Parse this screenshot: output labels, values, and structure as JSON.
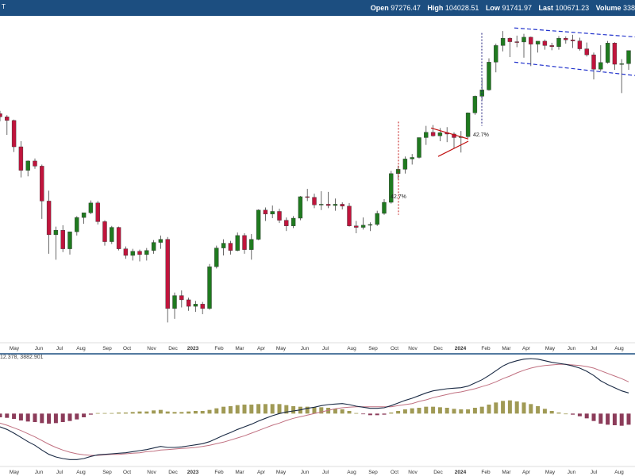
{
  "header": {
    "symbol_fragment": "T",
    "open_label": "Open",
    "open_value": "97276.47",
    "high_label": "High",
    "high_value": "104028.51",
    "low_label": "Low",
    "low_value": "91741.97",
    "last_label": "Last",
    "last_value": "100671.23",
    "volume_label": "Volume",
    "volume_value": "338"
  },
  "macd_readout": "12.378, 3882.901",
  "colors": {
    "up": "#1f7a1f",
    "down": "#c0143c",
    "header": "#1c4e80",
    "macd_line": "#1a2a44",
    "signal_line": "#c07080",
    "hist_pos": "#a09a55",
    "hist_neg": "#8c3c5a",
    "channel": "#2233cc",
    "annotation": "#c01010"
  },
  "annotations": [
    {
      "text": "42.7%"
    },
    {
      "text": "42.7%"
    }
  ],
  "chart_data": [
    {
      "type": "candlestick",
      "timeframe": "weekly",
      "x_axis_labels": [
        "May",
        "Jun",
        "Jul",
        "Aug",
        "Sep",
        "Oct",
        "Nov",
        "Dec",
        "2023",
        "Feb",
        "Mar",
        "Apr",
        "May",
        "Jun",
        "Jul",
        "Aug",
        "Sep",
        "Oct",
        "Nov",
        "Dec",
        "2024",
        "Feb",
        "Mar",
        "Apr",
        "May",
        "Jun",
        "Jul",
        "Aug"
      ],
      "series": [
        {
          "o": 47500,
          "h": 48200,
          "l": 45600,
          "c": 46700
        },
        {
          "o": 46700,
          "h": 47100,
          "l": 42400,
          "c": 45800
        },
        {
          "o": 45800,
          "h": 46000,
          "l": 38700,
          "c": 39800
        },
        {
          "o": 39800,
          "h": 41000,
          "l": 33800,
          "c": 35100
        },
        {
          "o": 35100,
          "h": 37000,
          "l": 34000,
          "c": 36900
        },
        {
          "o": 36900,
          "h": 37400,
          "l": 35400,
          "c": 35900
        },
        {
          "o": 35900,
          "h": 36200,
          "l": 27100,
          "c": 29800
        },
        {
          "o": 29800,
          "h": 31500,
          "l": 22500,
          "c": 24900
        },
        {
          "o": 24900,
          "h": 26000,
          "l": 21800,
          "c": 25500
        },
        {
          "o": 25500,
          "h": 26200,
          "l": 22700,
          "c": 23100
        },
        {
          "o": 23100,
          "h": 25300,
          "l": 22400,
          "c": 25300
        },
        {
          "o": 25300,
          "h": 27500,
          "l": 24800,
          "c": 27300
        },
        {
          "o": 27300,
          "h": 27600,
          "l": 26400,
          "c": 28000
        },
        {
          "o": 28000,
          "h": 29900,
          "l": 27800,
          "c": 29500
        },
        {
          "o": 29500,
          "h": 29800,
          "l": 26300,
          "c": 26700
        },
        {
          "o": 26700,
          "h": 26900,
          "l": 23500,
          "c": 24000
        },
        {
          "o": 24000,
          "h": 26100,
          "l": 23700,
          "c": 25900
        },
        {
          "o": 25900,
          "h": 26000,
          "l": 22900,
          "c": 23100
        },
        {
          "o": 23100,
          "h": 23400,
          "l": 21900,
          "c": 22300
        },
        {
          "o": 22300,
          "h": 23100,
          "l": 21700,
          "c": 22800
        },
        {
          "o": 22800,
          "h": 23000,
          "l": 21600,
          "c": 22400
        },
        {
          "o": 22400,
          "h": 23200,
          "l": 21700,
          "c": 22900
        },
        {
          "o": 22900,
          "h": 24200,
          "l": 22500,
          "c": 23900
        },
        {
          "o": 23900,
          "h": 24800,
          "l": 23100,
          "c": 24300
        },
        {
          "o": 24300,
          "h": 24600,
          "l": 15600,
          "c": 16800
        },
        {
          "o": 16800,
          "h": 18300,
          "l": 15900,
          "c": 18000
        },
        {
          "o": 18000,
          "h": 18500,
          "l": 16900,
          "c": 17600
        },
        {
          "o": 17600,
          "h": 17800,
          "l": 16600,
          "c": 17000
        },
        {
          "o": 17000,
          "h": 17500,
          "l": 16500,
          "c": 17200
        },
        {
          "o": 17200,
          "h": 17400,
          "l": 16300,
          "c": 16800
        },
        {
          "o": 16800,
          "h": 21300,
          "l": 16700,
          "c": 21000
        },
        {
          "o": 21000,
          "h": 23500,
          "l": 20800,
          "c": 23200
        },
        {
          "o": 23200,
          "h": 24300,
          "l": 22300,
          "c": 23800
        },
        {
          "o": 23800,
          "h": 24100,
          "l": 22400,
          "c": 22900
        },
        {
          "o": 22900,
          "h": 25200,
          "l": 22800,
          "c": 24800
        },
        {
          "o": 24800,
          "h": 25100,
          "l": 22500,
          "c": 23000
        },
        {
          "o": 23000,
          "h": 25000,
          "l": 21800,
          "c": 24300
        },
        {
          "o": 24300,
          "h": 28500,
          "l": 24200,
          "c": 28400
        },
        {
          "o": 28400,
          "h": 28800,
          "l": 26800,
          "c": 27800
        },
        {
          "o": 27800,
          "h": 29100,
          "l": 27200,
          "c": 28200
        },
        {
          "o": 28200,
          "h": 28600,
          "l": 26500,
          "c": 26900
        },
        {
          "o": 26900,
          "h": 27300,
          "l": 25400,
          "c": 26100
        },
        {
          "o": 26100,
          "h": 27500,
          "l": 25800,
          "c": 27200
        },
        {
          "o": 27200,
          "h": 30600,
          "l": 26900,
          "c": 30500
        },
        {
          "o": 30500,
          "h": 31800,
          "l": 29800,
          "c": 30400
        },
        {
          "o": 30400,
          "h": 31000,
          "l": 28700,
          "c": 29200
        },
        {
          "o": 29200,
          "h": 31400,
          "l": 28400,
          "c": 29300
        },
        {
          "o": 29300,
          "h": 31300,
          "l": 28700,
          "c": 29100
        },
        {
          "o": 29100,
          "h": 30200,
          "l": 28300,
          "c": 29300
        },
        {
          "o": 29300,
          "h": 29600,
          "l": 28500,
          "c": 29000
        },
        {
          "o": 29000,
          "h": 29500,
          "l": 26000,
          "c": 26100
        },
        {
          "o": 26100,
          "h": 26800,
          "l": 25100,
          "c": 25900
        },
        {
          "o": 25900,
          "h": 27300,
          "l": 25600,
          "c": 26200
        },
        {
          "o": 26200,
          "h": 26600,
          "l": 25400,
          "c": 26300
        },
        {
          "o": 26300,
          "h": 28300,
          "l": 26100,
          "c": 27900
        },
        {
          "o": 27900,
          "h": 30100,
          "l": 27700,
          "c": 29600
        },
        {
          "o": 29600,
          "h": 35000,
          "l": 29400,
          "c": 34500
        },
        {
          "o": 34500,
          "h": 36000,
          "l": 33500,
          "c": 35300
        },
        {
          "o": 35300,
          "h": 37800,
          "l": 34500,
          "c": 37300
        },
        {
          "o": 37300,
          "h": 38300,
          "l": 36200,
          "c": 37600
        },
        {
          "o": 37600,
          "h": 41600,
          "l": 37400,
          "c": 41800
        },
        {
          "o": 41800,
          "h": 44500,
          "l": 40200,
          "c": 43000
        },
        {
          "o": 43000,
          "h": 44700,
          "l": 42000,
          "c": 42200
        },
        {
          "o": 42200,
          "h": 44000,
          "l": 41000,
          "c": 42900
        },
        {
          "o": 42900,
          "h": 44200,
          "l": 40800,
          "c": 42600
        },
        {
          "o": 42600,
          "h": 43000,
          "l": 39500,
          "c": 41800
        },
        {
          "o": 41800,
          "h": 43300,
          "l": 38600,
          "c": 42000
        },
        {
          "o": 42000,
          "h": 47800,
          "l": 41700,
          "c": 47700
        },
        {
          "o": 47700,
          "h": 52300,
          "l": 47200,
          "c": 52100
        },
        {
          "o": 52100,
          "h": 57400,
          "l": 51000,
          "c": 53900
        },
        {
          "o": 53900,
          "h": 63800,
          "l": 53700,
          "c": 62500
        },
        {
          "o": 62500,
          "h": 69000,
          "l": 59200,
          "c": 68300
        },
        {
          "o": 68300,
          "h": 73800,
          "l": 66200,
          "c": 71000
        },
        {
          "o": 71000,
          "h": 71300,
          "l": 64200,
          "c": 69700
        },
        {
          "o": 69700,
          "h": 72000,
          "l": 67700,
          "c": 69600
        },
        {
          "o": 69600,
          "h": 72700,
          "l": 64000,
          "c": 71400
        },
        {
          "o": 71400,
          "h": 71600,
          "l": 61200,
          "c": 68800
        },
        {
          "o": 68800,
          "h": 69400,
          "l": 65800,
          "c": 69900
        },
        {
          "o": 69900,
          "h": 70500,
          "l": 66800,
          "c": 68300
        },
        {
          "o": 68300,
          "h": 69300,
          "l": 66600,
          "c": 67900
        },
        {
          "o": 67900,
          "h": 71800,
          "l": 66800,
          "c": 71000
        },
        {
          "o": 71000,
          "h": 71700,
          "l": 69000,
          "c": 70400
        },
        {
          "o": 70400,
          "h": 72300,
          "l": 67400,
          "c": 70000
        },
        {
          "o": 70000,
          "h": 71200,
          "l": 66500,
          "c": 67100
        },
        {
          "o": 67100,
          "h": 69400,
          "l": 64400,
          "c": 65000
        },
        {
          "o": 65000,
          "h": 65800,
          "l": 57000,
          "c": 60200
        },
        {
          "o": 60200,
          "h": 68400,
          "l": 59500,
          "c": 62400
        },
        {
          "o": 62400,
          "h": 70000,
          "l": 62000,
          "c": 69200
        },
        {
          "o": 69200,
          "h": 69500,
          "l": 60000,
          "c": 61800
        },
        {
          "o": 61800,
          "h": 63500,
          "l": 53000,
          "c": 62000
        },
        {
          "o": 62000,
          "h": 66500,
          "l": 60000,
          "c": 66500
        }
      ]
    },
    {
      "type": "macd",
      "readout": "12.378, 3882.901",
      "macd": [
        -2500,
        -3000,
        -3700,
        -4500,
        -5300,
        -6000,
        -6900,
        -7700,
        -8200,
        -8500,
        -8700,
        -8700,
        -8500,
        -8100,
        -7800,
        -7700,
        -7600,
        -7500,
        -7400,
        -7200,
        -7000,
        -6800,
        -6500,
        -6200,
        -6400,
        -6400,
        -6300,
        -6100,
        -5900,
        -5700,
        -5300,
        -4700,
        -4100,
        -3600,
        -3000,
        -2500,
        -2000,
        -1400,
        -900,
        -400,
        0,
        300,
        500,
        700,
        1000,
        1200,
        1500,
        1700,
        1800,
        1900,
        1700,
        1400,
        1200,
        1000,
        1000,
        1100,
        1500,
        2000,
        2500,
        2900,
        3400,
        3900,
        4300,
        4500,
        4700,
        4800,
        4900,
        5200,
        5800,
        6400,
        7200,
        8100,
        9000,
        9600,
        10000,
        10300,
        10400,
        10300,
        10000,
        9700,
        9500,
        9300,
        9000,
        8600,
        8000,
        7200,
        6200,
        5500,
        4900,
        4300,
        3900
      ],
      "signal": [
        -1800,
        -2200,
        -2700,
        -3200,
        -3800,
        -4400,
        -5100,
        -5800,
        -6400,
        -6900,
        -7300,
        -7600,
        -7800,
        -7900,
        -7900,
        -7800,
        -7700,
        -7700,
        -7600,
        -7500,
        -7400,
        -7200,
        -7100,
        -6900,
        -6800,
        -6700,
        -6600,
        -6500,
        -6400,
        -6200,
        -6000,
        -5700,
        -5400,
        -5000,
        -4600,
        -4200,
        -3700,
        -3200,
        -2700,
        -2200,
        -1800,
        -1300,
        -900,
        -600,
        -300,
        0,
        300,
        600,
        900,
        1100,
        1200,
        1300,
        1300,
        1300,
        1300,
        1300,
        1300,
        1500,
        1700,
        1900,
        2300,
        2600,
        3000,
        3300,
        3600,
        3900,
        4100,
        4400,
        4700,
        5100,
        5500,
        6000,
        6600,
        7100,
        7700,
        8200,
        8600,
        8900,
        9100,
        9200,
        9300,
        9300,
        9200,
        9100,
        8900,
        8600,
        8100,
        7600,
        7100,
        6600,
        6000
      ],
      "histogram": [
        -700,
        -800,
        -1000,
        -1300,
        -1500,
        -1600,
        -1800,
        -1900,
        -1800,
        -1600,
        -1400,
        -1100,
        -700,
        -200,
        100,
        100,
        100,
        200,
        200,
        300,
        400,
        400,
        600,
        700,
        400,
        300,
        300,
        400,
        500,
        500,
        700,
        1000,
        1300,
        1400,
        1600,
        1700,
        1700,
        1800,
        1800,
        1800,
        1800,
        1600,
        1400,
        1300,
        1300,
        1200,
        1200,
        1100,
        900,
        800,
        500,
        100,
        -100,
        -300,
        -300,
        -200,
        200,
        500,
        800,
        1000,
        1100,
        1300,
        1300,
        1200,
        1100,
        900,
        800,
        800,
        1100,
        1300,
        1700,
        2100,
        2400,
        2500,
        2300,
        2100,
        1800,
        1400,
        900,
        500,
        200,
        0,
        -200,
        -500,
        -900,
        -1400,
        -1900,
        -2100,
        -2200,
        -2300,
        -2100
      ]
    }
  ]
}
